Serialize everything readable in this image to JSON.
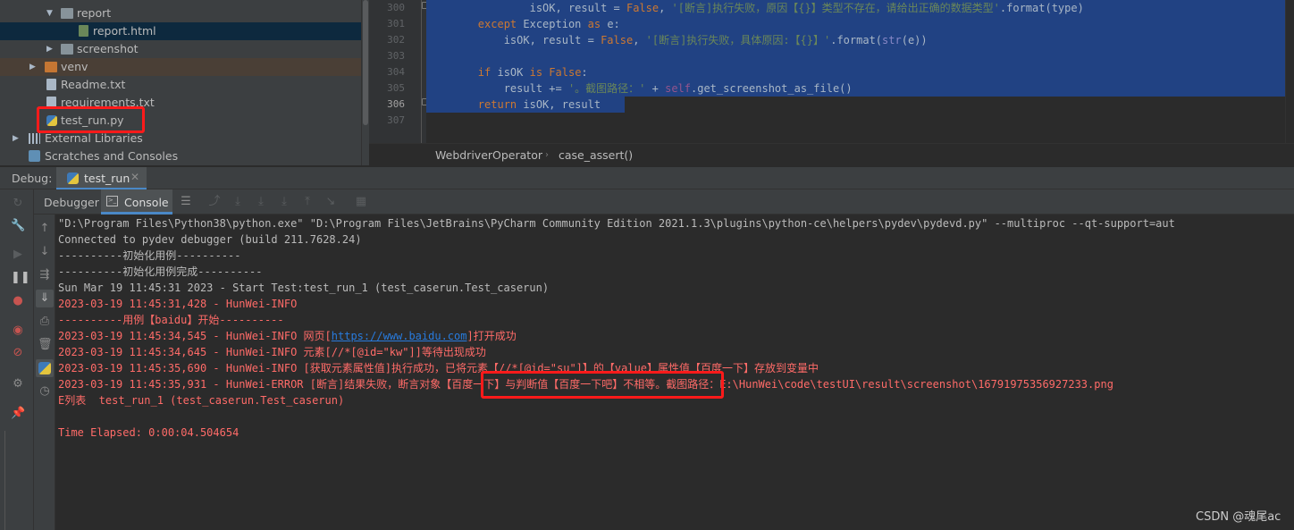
{
  "project_tree": {
    "items": [
      {
        "label": "report",
        "kind": "folder"
      },
      {
        "label": "report.html",
        "kind": "html"
      },
      {
        "label": "screenshot",
        "kind": "folder"
      },
      {
        "label": "venv",
        "kind": "folder-orange"
      },
      {
        "label": "Readme.txt",
        "kind": "txt"
      },
      {
        "label": "requirements.txt",
        "kind": "txt"
      },
      {
        "label": "test_run.py",
        "kind": "py"
      },
      {
        "label": "External Libraries",
        "kind": "libs"
      },
      {
        "label": "Scratches and Consoles",
        "kind": "scratch"
      }
    ]
  },
  "editor": {
    "line_numbers": [
      "300",
      "301",
      "302",
      "303",
      "304",
      "305",
      "306",
      "307"
    ],
    "lines": [
      {
        "indent": "                ",
        "p1": "isOK, result = ",
        "kw1": "False",
        "p2": ", ",
        "str": "'[断言]执行失败，原因【{}】类型不存在，请给出正确的数据类型'",
        "p3": ".format(type)"
      },
      {
        "indent": "        ",
        "kw1": "except ",
        "p1": "Exception ",
        "kw2": "as ",
        "p2": "e:"
      },
      {
        "indent": "            ",
        "p1": "isOK, result = ",
        "kw1": "False",
        "p2": ", ",
        "str": "'[断言]执行失败，具体原因:【{}】'",
        "p3": ".format(",
        "bi": "str",
        "p4": "(e))"
      },
      {
        "text": ""
      },
      {
        "indent": "        ",
        "kw1": "if ",
        "p1": "isOK ",
        "kw2": "is ",
        "kw3": "False",
        "p2": ":"
      },
      {
        "indent": "            ",
        "p1": "result += ",
        "str": "'。截图路径：'",
        "p2": " + ",
        "sf": "self",
        "p3": ".get_screenshot_as_file()"
      },
      {
        "indent": "        ",
        "kw1": "return ",
        "p1": "isOK, result"
      },
      {
        "text": ""
      }
    ],
    "breadcrumbs": [
      "WebdriverOperator",
      "case_assert()"
    ]
  },
  "debug": {
    "label": "Debug:",
    "run_tab": "test_run",
    "tabs": [
      "Debugger",
      "Console"
    ]
  },
  "console": {
    "lines": [
      {
        "text": "\"D:\\Program Files\\Python38\\python.exe\" \"D:\\Program Files\\JetBrains\\PyCharm Community Edition 2021.1.3\\plugins\\python-ce\\helpers\\pydev\\pydevd.py\" --multiproc --qt-support=aut",
        "style": "normal"
      },
      {
        "text": "Connected to pydev debugger (build 211.7628.24)",
        "style": "normal"
      },
      {
        "text": "----------初始化用例----------",
        "style": "normal"
      },
      {
        "text": "----------初始化用例完成----------",
        "style": "normal"
      },
      {
        "text": "Sun Mar 19 11:45:31 2023 - Start Test:test_run_1 (test_caserun.Test_caserun)",
        "style": "normal"
      },
      {
        "text": "2023-03-19 11:45:31,428 - HunWei-INFO",
        "style": "err"
      },
      {
        "text": "----------用例【baidu】开始----------",
        "style": "err"
      },
      {
        "pre": "2023-03-19 11:45:34,545 - HunWei-INFO 网页[",
        "link": "https://www.baidu.com",
        "post": "]打开成功",
        "style": "err"
      },
      {
        "text": "2023-03-19 11:45:34,645 - HunWei-INFO 元素[//*[@id=\"kw\"]]等待出现成功",
        "style": "err"
      },
      {
        "text": "2023-03-19 11:45:35,690 - HunWei-INFO [获取元素属性值]执行成功，已将元素【//*[@id=\"su\"]】的【value】属性值【百度一下】存放到变量中",
        "style": "err"
      },
      {
        "text": "2023-03-19 11:45:35,931 - HunWei-ERROR [断言]结果失败，断言对象【百度一下】与判断值【百度一下吧】不相等。截图路径：E:\\HunWei\\code\\testUI\\result\\screenshot\\16791975356927233.png",
        "style": "err"
      },
      {
        "text": "E列表  test_run_1 (test_caserun.Test_caserun)",
        "style": "err"
      },
      {
        "text": "",
        "style": "err"
      },
      {
        "text": "Time Elapsed: 0:00:04.504654",
        "style": "err"
      }
    ]
  },
  "watermark": "CSDN @魂尾ac",
  "colors": {
    "highlight": "#ff1a1a",
    "selection": "#214283",
    "error_text": "#ff6b68"
  }
}
